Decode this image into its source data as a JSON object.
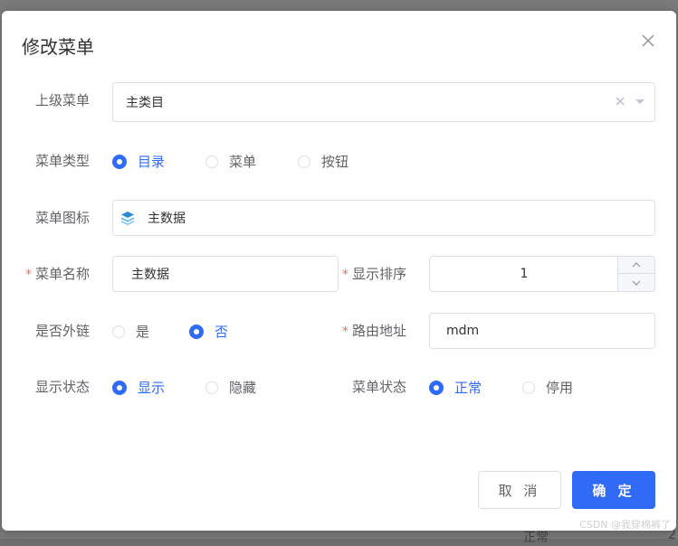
{
  "dialog": {
    "title": "修改菜单"
  },
  "form": {
    "parent_menu": {
      "label": "上级菜单",
      "value": "主类目"
    },
    "menu_type": {
      "label": "菜单类型",
      "options": [
        "目录",
        "菜单",
        "按钮"
      ],
      "selected": "目录"
    },
    "menu_icon": {
      "label": "菜单图标",
      "value": "主数据",
      "icon": "database-icon"
    },
    "menu_name": {
      "label": "菜单名称",
      "value": "主数据",
      "required": true
    },
    "display_order": {
      "label": "显示排序",
      "value": "1",
      "required": true
    },
    "is_external": {
      "label": "是否外链",
      "options": [
        "是",
        "否"
      ],
      "selected": "否"
    },
    "route_path": {
      "label": "路由地址",
      "value": "mdm",
      "required": true
    },
    "visible": {
      "label": "显示状态",
      "options": [
        "显示",
        "隐藏"
      ],
      "selected": "显示"
    },
    "status": {
      "label": "菜单状态",
      "options": [
        "正常",
        "停用"
      ],
      "selected": "正常"
    }
  },
  "footer": {
    "cancel_label": "取 消",
    "ok_label": "确 定"
  },
  "background": {
    "text_1": "正常",
    "text_2": "2"
  },
  "watermark": "CSDN @我穿棉裤了",
  "colors": {
    "primary": "#2f6bf6",
    "required": "#f56c6c",
    "border": "#dcdfe6"
  }
}
